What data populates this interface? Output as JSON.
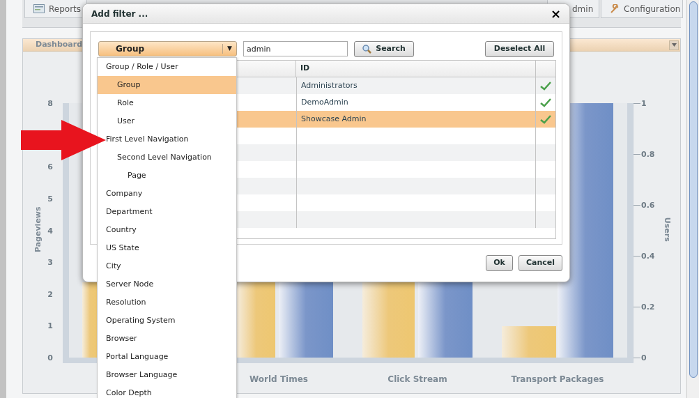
{
  "top_tabs": [
    {
      "label": "Reports",
      "kind": "reports"
    },
    {
      "label": "dmin",
      "kind": "admin"
    },
    {
      "label": "Configuration",
      "kind": "config"
    }
  ],
  "panel": {
    "title": "Dashboard"
  },
  "chart": {
    "left_axis": {
      "title": "Pageviews",
      "ticks": [
        "8",
        "6",
        "5",
        "4",
        "3",
        "2",
        "1",
        "0"
      ]
    },
    "right_axis": {
      "title": "Users",
      "ticks": [
        "1",
        "0.8",
        "0.6",
        "0.4",
        "0.2",
        "0"
      ]
    },
    "categories": [
      "World Times",
      "Click Stream",
      "Transport Packages"
    ]
  },
  "dialog": {
    "title": "Add filter ...",
    "close": "×",
    "filter_type": {
      "value": "Group",
      "arrow": "▼"
    },
    "search": {
      "value": "admin",
      "button": "Search"
    },
    "deselect_button": "Deselect All",
    "table": {
      "columns": [
        "ID"
      ],
      "rows": [
        {
          "id": "Administrators",
          "checked": true,
          "selected": false
        },
        {
          "id": "DemoAdmin",
          "checked": true,
          "selected": false
        },
        {
          "id": "Showcase Admin",
          "checked": true,
          "selected": true
        }
      ]
    },
    "buttons": [
      "Ok",
      "Cancel"
    ]
  },
  "dropdown": {
    "items": [
      {
        "label": "Group / Role / User",
        "selected": false,
        "children": [
          {
            "label": "Group",
            "selected": true
          },
          {
            "label": "Role",
            "selected": false
          },
          {
            "label": "User",
            "selected": false
          }
        ]
      },
      {
        "label": "First Level Navigation",
        "selected": false,
        "children": [
          {
            "label": "Second Level Navigation",
            "selected": false,
            "children": [
              {
                "label": "Page",
                "selected": false
              }
            ]
          }
        ]
      },
      {
        "label": "Company",
        "selected": false
      },
      {
        "label": "Department",
        "selected": false
      },
      {
        "label": "Country",
        "selected": false
      },
      {
        "label": "US State",
        "selected": false
      },
      {
        "label": "City",
        "selected": false
      },
      {
        "label": "Server Node",
        "selected": false
      },
      {
        "label": "Resolution",
        "selected": false
      },
      {
        "label": "Operating System",
        "selected": false
      },
      {
        "label": "Browser",
        "selected": false
      },
      {
        "label": "Portal Language",
        "selected": false
      },
      {
        "label": "Browser Language",
        "selected": false
      },
      {
        "label": "Color Depth",
        "selected": false
      }
    ]
  }
}
